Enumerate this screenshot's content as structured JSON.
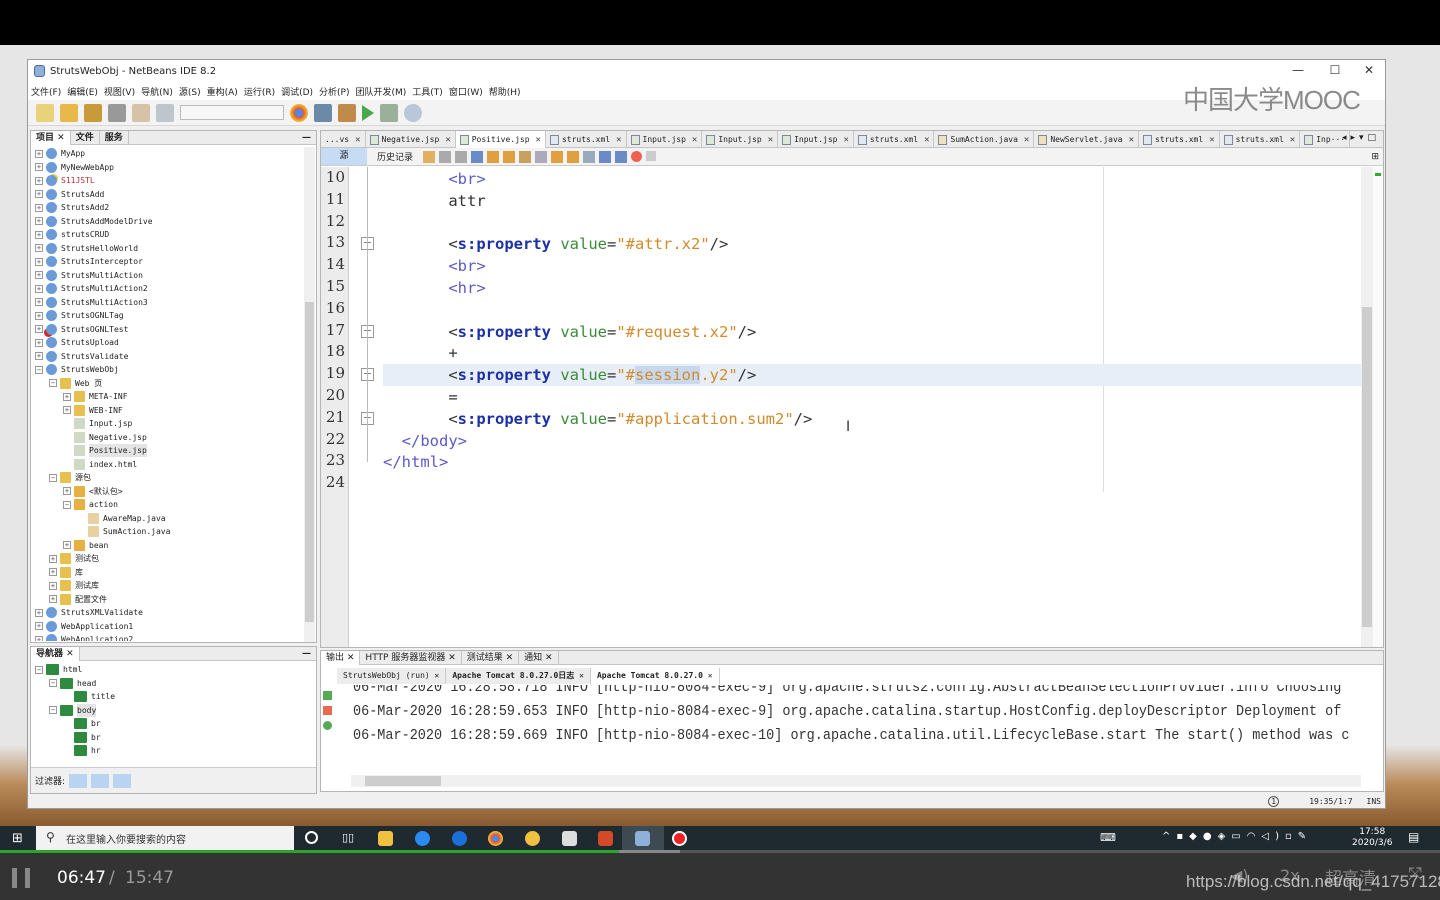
{
  "window": {
    "title": "StrutsWebObj - NetBeans IDE 8.2",
    "watermark": "中国大学MOOC",
    "controls": [
      "—",
      "☐",
      "✕"
    ]
  },
  "menu": [
    "文件(F)",
    "编辑(E)",
    "视图(V)",
    "导航(N)",
    "源(S)",
    "重构(A)",
    "运行(R)",
    "调试(D)",
    "分析(P)",
    "团队开发(M)",
    "工具(T)",
    "窗口(W)",
    "帮助(H)"
  ],
  "project_panel": {
    "tabs": [
      "项目",
      "文件",
      "服务"
    ],
    "tree": [
      {
        "d": 0,
        "label": "MyApp",
        "icon": "globe",
        "exp": "+"
      },
      {
        "d": 0,
        "label": "MyNewWebApp",
        "icon": "globe",
        "exp": "+"
      },
      {
        "d": 0,
        "label": "S11JSTL",
        "icon": "globe-warn",
        "exp": "+",
        "color": "#b03030"
      },
      {
        "d": 0,
        "label": "StrutsAdd",
        "icon": "globe",
        "exp": "+"
      },
      {
        "d": 0,
        "label": "StrutsAdd2",
        "icon": "globe",
        "exp": "+"
      },
      {
        "d": 0,
        "label": "StrutsAddModelDrive",
        "icon": "globe",
        "exp": "+"
      },
      {
        "d": 0,
        "label": "strutsCRUD",
        "icon": "globe",
        "exp": "+"
      },
      {
        "d": 0,
        "label": "StrutsHelloWorld",
        "icon": "globe",
        "exp": "+"
      },
      {
        "d": 0,
        "label": "StrutsInterceptor",
        "icon": "globe",
        "exp": "+"
      },
      {
        "d": 0,
        "label": "StrutsMultiAction",
        "icon": "globe",
        "exp": "+"
      },
      {
        "d": 0,
        "label": "StrutsMultiAction2",
        "icon": "globe",
        "exp": "+"
      },
      {
        "d": 0,
        "label": "StrutsMultiAction3",
        "icon": "globe",
        "exp": "+"
      },
      {
        "d": 0,
        "label": "StrutsOGNLTag",
        "icon": "globe",
        "exp": "+"
      },
      {
        "d": 0,
        "label": "StrutsOGNLTest",
        "icon": "globe-error",
        "exp": "+"
      },
      {
        "d": 0,
        "label": "StrutsUpload",
        "icon": "globe",
        "exp": "+"
      },
      {
        "d": 0,
        "label": "StrutsValidate",
        "icon": "globe",
        "exp": "+"
      },
      {
        "d": 0,
        "label": "StrutsWebObj",
        "icon": "globe",
        "exp": "-"
      },
      {
        "d": 1,
        "label": "Web 页",
        "icon": "folder",
        "exp": "-"
      },
      {
        "d": 2,
        "label": "META-INF",
        "icon": "folder",
        "exp": "+"
      },
      {
        "d": 2,
        "label": "WEB-INF",
        "icon": "folder",
        "exp": "+"
      },
      {
        "d": 2,
        "label": "Input.jsp",
        "icon": "file"
      },
      {
        "d": 2,
        "label": "Negative.jsp",
        "icon": "file"
      },
      {
        "d": 2,
        "label": "Positive.jsp",
        "icon": "file",
        "selected": true
      },
      {
        "d": 2,
        "label": "index.html",
        "icon": "file"
      },
      {
        "d": 1,
        "label": "源包",
        "icon": "folder",
        "exp": "-"
      },
      {
        "d": 2,
        "label": "<默认包>",
        "icon": "package",
        "exp": "+"
      },
      {
        "d": 2,
        "label": "action",
        "icon": "package",
        "exp": "-"
      },
      {
        "d": 3,
        "label": "AwareMap.java",
        "icon": "java"
      },
      {
        "d": 3,
        "label": "SumAction.java",
        "icon": "java"
      },
      {
        "d": 2,
        "label": "bean",
        "icon": "package",
        "exp": "+"
      },
      {
        "d": 1,
        "label": "测试包",
        "icon": "folder",
        "exp": "+"
      },
      {
        "d": 1,
        "label": "库",
        "icon": "folder",
        "exp": "+"
      },
      {
        "d": 1,
        "label": "测试库",
        "icon": "folder",
        "exp": "+"
      },
      {
        "d": 1,
        "label": "配置文件",
        "icon": "folder",
        "exp": "+"
      },
      {
        "d": 0,
        "label": "StrutsXMLValidate",
        "icon": "globe",
        "exp": "+"
      },
      {
        "d": 0,
        "label": "WebApplication1",
        "icon": "globe",
        "exp": "+"
      },
      {
        "d": 0,
        "label": "WebApplication2",
        "icon": "globe",
        "exp": "+"
      }
    ]
  },
  "navigator": {
    "tab": "导航器",
    "tree": [
      {
        "d": 0,
        "label": "html",
        "exp": "-"
      },
      {
        "d": 1,
        "label": "head",
        "exp": "-"
      },
      {
        "d": 2,
        "label": "title"
      },
      {
        "d": 1,
        "label": "body",
        "exp": "-",
        "selected": true
      },
      {
        "d": 2,
        "label": "br"
      },
      {
        "d": 2,
        "label": "br"
      },
      {
        "d": 2,
        "label": "hr"
      }
    ],
    "filter_label": "过滤器:"
  },
  "editor": {
    "tabs": [
      {
        "label": "...vs",
        "type": "none"
      },
      {
        "label": "Negative.jsp",
        "type": "jsp"
      },
      {
        "label": "Positive.jsp",
        "type": "jsp",
        "active": true
      },
      {
        "label": "struts.xml",
        "type": "xml"
      },
      {
        "label": "Input.jsp",
        "type": "jsp"
      },
      {
        "label": "Input.jsp",
        "type": "jsp"
      },
      {
        "label": "Input.jsp",
        "type": "jsp"
      },
      {
        "label": "struts.xml",
        "type": "xml"
      },
      {
        "label": "SumAction.java",
        "type": "java"
      },
      {
        "label": "NewServlet.java",
        "type": "java"
      },
      {
        "label": "struts.xml",
        "type": "xml"
      },
      {
        "label": "struts.xml",
        "type": "xml"
      },
      {
        "label": "Inp···",
        "type": "jsp"
      }
    ],
    "source_tab": "源",
    "history_tab": "历史记录",
    "colors": {
      "tag": "#5a5ac8",
      "sprop": "#1c2fa8",
      "attr": "#3a8a3a",
      "string": "#d08a2a",
      "text": "#333333",
      "selection": "#c8d8ef",
      "current_line": "#e8eef8"
    },
    "lines": [
      {
        "n": "10",
        "tok": [
          [
            "       ",
            "text"
          ],
          [
            "<br>",
            "tag"
          ]
        ]
      },
      {
        "n": "11",
        "tok": [
          [
            "       attr",
            "text"
          ]
        ]
      },
      {
        "n": "12",
        "tok": []
      },
      {
        "n": "13",
        "fold": true,
        "tok": [
          [
            "       ",
            "text"
          ],
          [
            "<",
            "text"
          ],
          [
            "s:property",
            "sprop"
          ],
          [
            " value",
            "attr"
          ],
          [
            "=",
            "text"
          ],
          [
            "\"#attr.x2\"",
            "string"
          ],
          [
            "/>",
            "text"
          ]
        ]
      },
      {
        "n": "14",
        "tok": [
          [
            "       ",
            "text"
          ],
          [
            "<br>",
            "tag"
          ]
        ]
      },
      {
        "n": "15",
        "tok": [
          [
            "       ",
            "text"
          ],
          [
            "<hr>",
            "tag"
          ]
        ]
      },
      {
        "n": "16",
        "tok": []
      },
      {
        "n": "17",
        "fold": true,
        "tok": [
          [
            "       ",
            "text"
          ],
          [
            "<",
            "text"
          ],
          [
            "s:property",
            "sprop"
          ],
          [
            " value",
            "attr"
          ],
          [
            "=",
            "text"
          ],
          [
            "\"#request.x2\"",
            "string"
          ],
          [
            "/>",
            "text"
          ]
        ]
      },
      {
        "n": "18",
        "tok": [
          [
            "       +",
            "text"
          ]
        ]
      },
      {
        "n": "19",
        "fold": true,
        "current": true,
        "tok": [
          [
            "       ",
            "text"
          ],
          [
            "<",
            "text"
          ],
          [
            "s:property",
            "sprop"
          ],
          [
            " value",
            "attr"
          ],
          [
            "=",
            "text"
          ],
          [
            "\"#",
            "string"
          ],
          [
            "session",
            "string-sel"
          ],
          [
            ".y2\"",
            "string"
          ],
          [
            "/>",
            "text"
          ]
        ]
      },
      {
        "n": "20",
        "tok": [
          [
            "       =",
            "text"
          ]
        ]
      },
      {
        "n": "21",
        "fold": true,
        "tok": [
          [
            "       ",
            "text"
          ],
          [
            "<",
            "text"
          ],
          [
            "s:property",
            "sprop"
          ],
          [
            " value",
            "attr"
          ],
          [
            "=",
            "text"
          ],
          [
            "\"#application.sum2\"",
            "string"
          ],
          [
            "/>",
            "text"
          ]
        ]
      },
      {
        "n": "22",
        "tok": [
          [
            "  ",
            "text"
          ],
          [
            "</body>",
            "tag"
          ]
        ]
      },
      {
        "n": "23",
        "tok": [
          [
            "</html>",
            "tag"
          ]
        ]
      },
      {
        "n": "24",
        "tok": []
      }
    ]
  },
  "output": {
    "tabs": [
      "输出",
      "HTTP 服务器监视器",
      "测试结果",
      "通知"
    ],
    "subtabs": [
      "StrutsWebObj (run)",
      "Apache Tomcat 8.0.27.0日志",
      "Apache Tomcat 8.0.27.0"
    ],
    "lines": [
      "06-Mar-2020 16:28:58.718 INFO [http-nio-8084-exec-9] org.apache.struts2.config.AbstractBeanSelectionProvider.info Choosing",
      "06-Mar-2020 16:28:59.653 INFO [http-nio-8084-exec-9] org.apache.catalina.startup.HostConfig.deployDescriptor Deployment of",
      "06-Mar-2020 16:28:59.669 INFO [http-nio-8084-exec-10] org.apache.catalina.util.LifecycleBase.start The start() method was c"
    ]
  },
  "statusbar": {
    "notifications": "1",
    "position": "19:35/1:7",
    "mode": "INS"
  },
  "taskbar": {
    "search_placeholder": "在这里输入你要搜索的内容",
    "time": "17:58",
    "date": "2020/3/6",
    "notification_count": "1"
  },
  "player": {
    "current": "06:47",
    "separator": "/",
    "total": "15:47",
    "progress": 0.43,
    "speed": "2x",
    "quality": "超高清",
    "url_watermark": "https://blog.csdn.net/qq_41757128"
  }
}
